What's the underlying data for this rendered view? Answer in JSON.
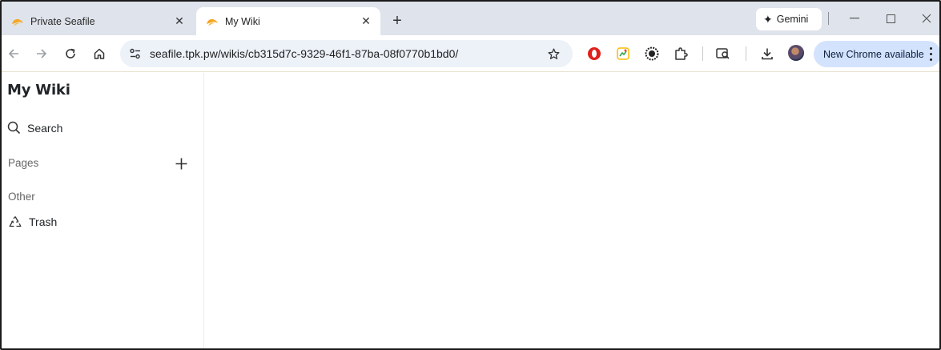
{
  "browser": {
    "tabs": [
      {
        "title": "Private Seafile",
        "active": false
      },
      {
        "title": "My Wiki",
        "active": true
      }
    ],
    "gemini_label": "Gemini",
    "address_url": "seafile.tpk.pw/wikis/cb315d7c-9329-46f1-87ba-08f0770b1bd0/",
    "update_label": "New Chrome available",
    "icons": [
      "back-arrow-icon",
      "forward-arrow-icon",
      "reload-icon",
      "home-icon",
      "site-settings-icon",
      "bookmark-star-icon",
      "download-icon",
      "extensions-icon"
    ]
  },
  "wiki": {
    "title": "My Wiki",
    "search_label": "Search",
    "pages_label": "Pages",
    "other_label": "Other",
    "trash_label": "Trash"
  },
  "colors": {
    "tabstrip_bg": "#dfe3eb",
    "omnibox_bg": "#edf1f8",
    "update_pill_bg": "#d3e3fd"
  }
}
